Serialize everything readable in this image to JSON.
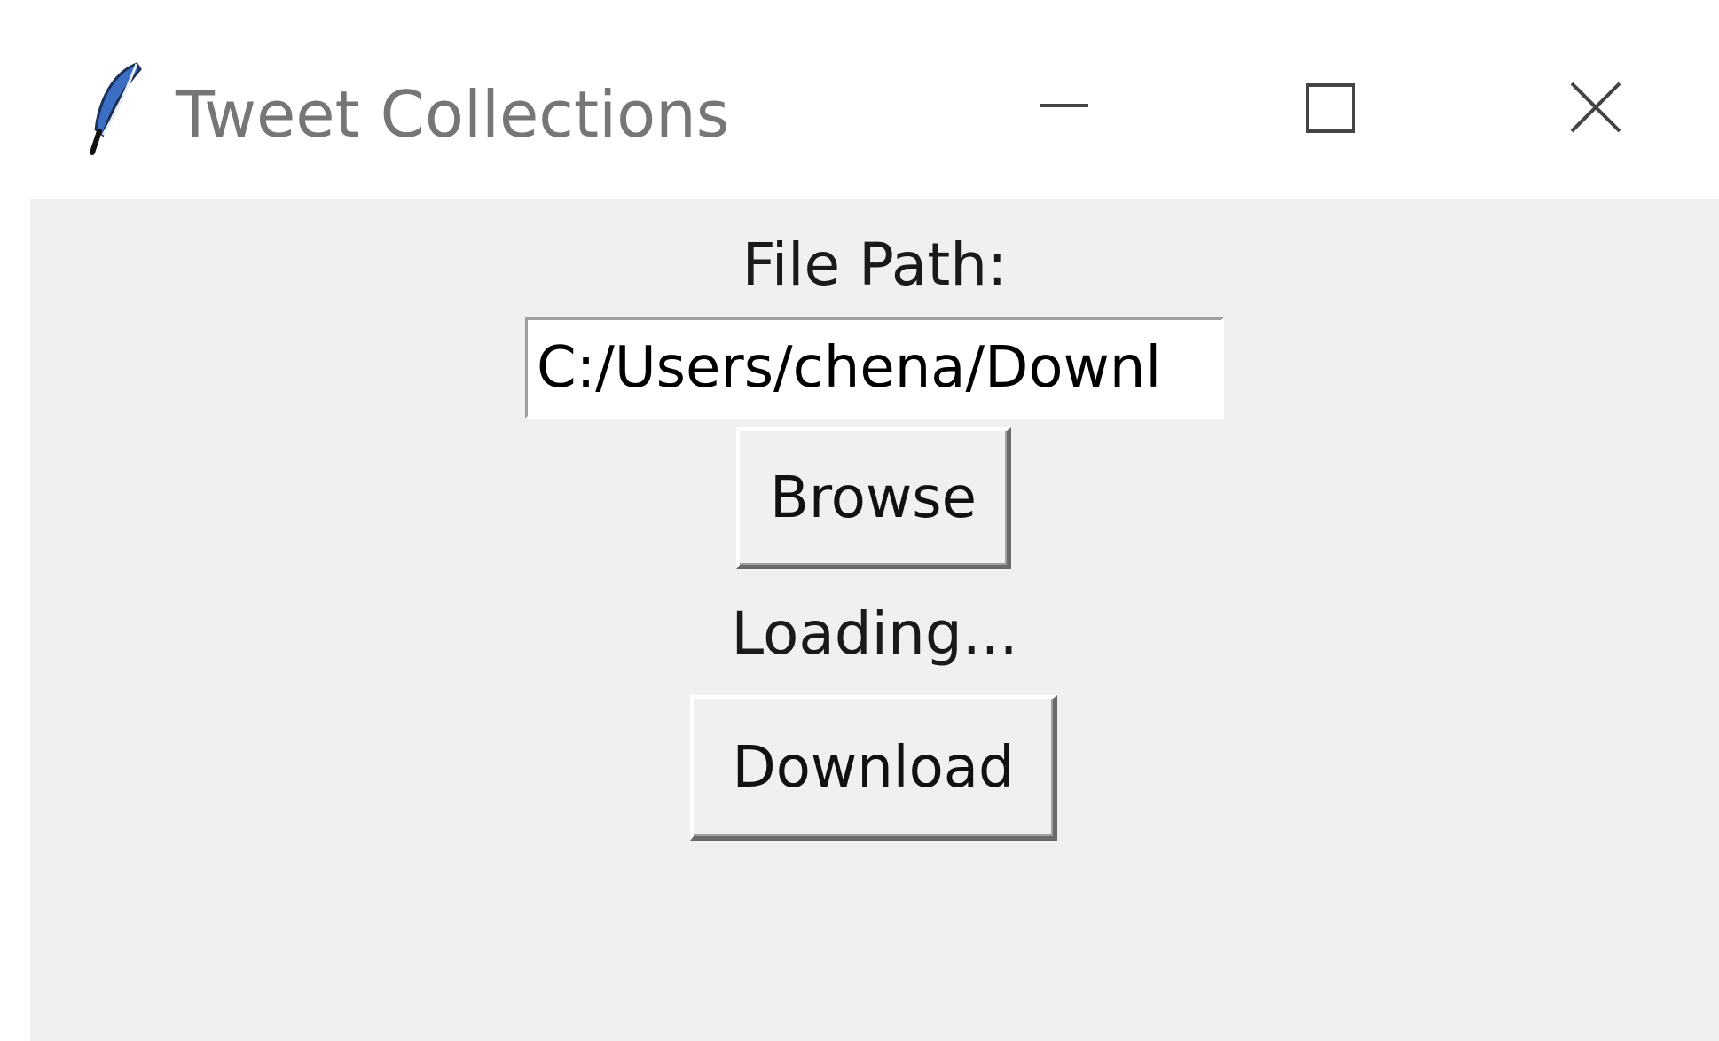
{
  "window": {
    "title": "Tweet Collections",
    "icon": "feather-icon",
    "controls": [
      "minimize-icon",
      "maximize-icon",
      "close-icon"
    ]
  },
  "form": {
    "file_path_label": "File Path:",
    "file_path_value": "C:/Users/chena/Downl",
    "browse_label": "Browse",
    "status_text": "Loading...",
    "download_label": "Download"
  }
}
